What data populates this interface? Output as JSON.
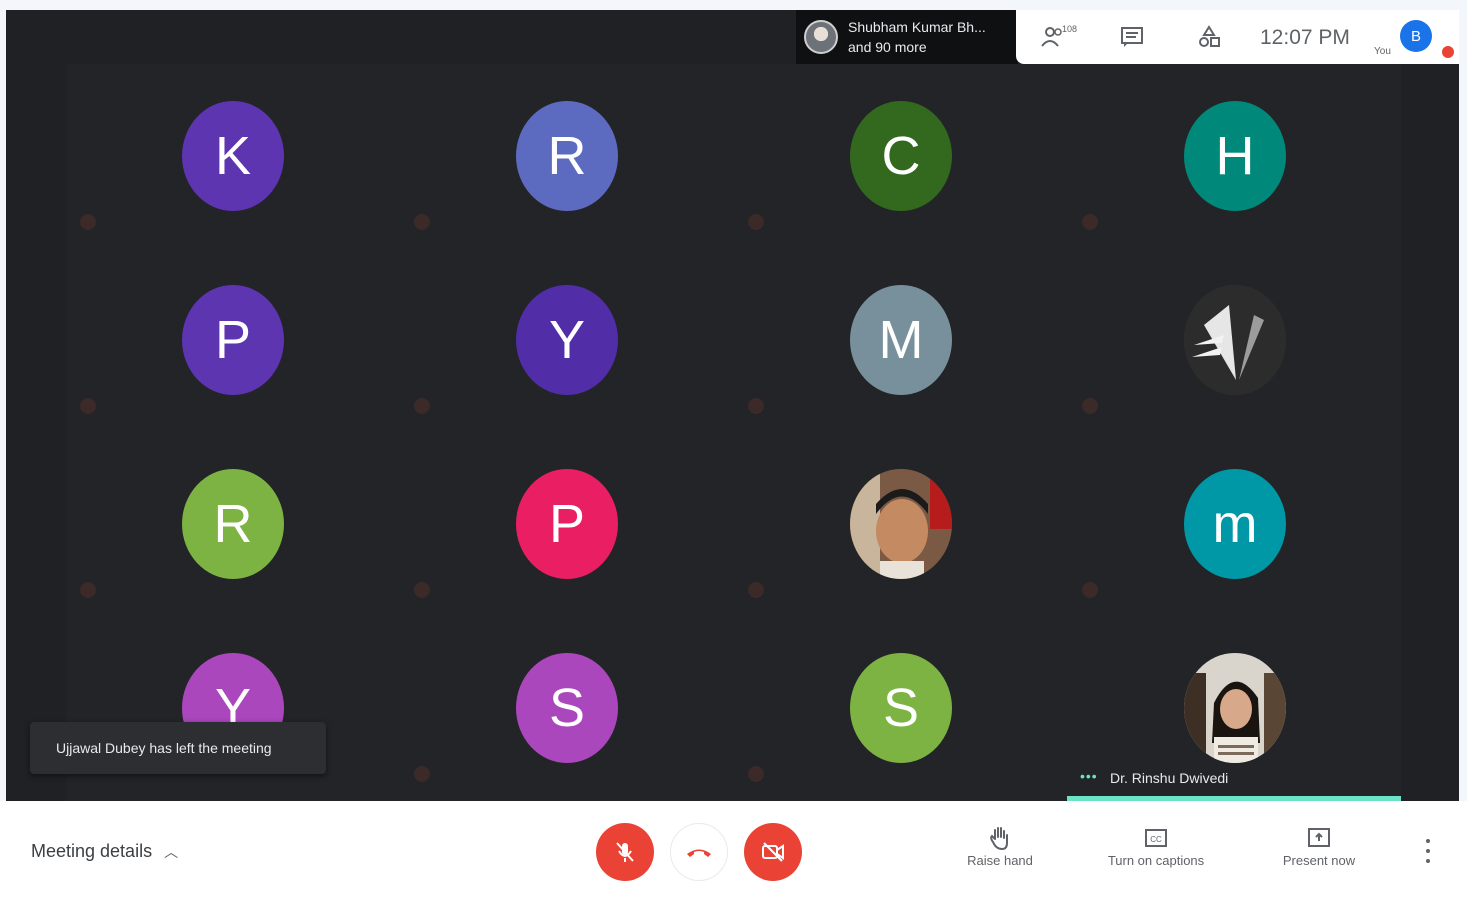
{
  "presenter": {
    "line1": "Shubham Kumar Bh...",
    "line2": "and 90 more"
  },
  "topbar": {
    "participant_count": "108",
    "time": "12:07 PM",
    "you_label": "You",
    "self_initial": "B"
  },
  "tiles": [
    {
      "initial": "K",
      "color": "#5e35b1",
      "name": ""
    },
    {
      "initial": "R",
      "color": "#5c6bc0",
      "name": ""
    },
    {
      "initial": "C",
      "color": "#33691e",
      "name": ""
    },
    {
      "initial": "H",
      "color": "#00897b",
      "name": ""
    },
    {
      "initial": "P",
      "color": "#5e35b1",
      "name": ""
    },
    {
      "initial": "Y",
      "color": "#512da8",
      "name": ""
    },
    {
      "initial": "M",
      "color": "#78909c",
      "name": ""
    },
    {
      "initial": "",
      "color": "#2b2b2b",
      "name": "",
      "photo": true
    },
    {
      "initial": "R",
      "color": "#7cb342",
      "name": ""
    },
    {
      "initial": "P",
      "color": "#e91e63",
      "name": ""
    },
    {
      "initial": "",
      "color": "#6d4c41",
      "name": "",
      "photo": true
    },
    {
      "initial": "m",
      "color": "#0097a7",
      "name": ""
    },
    {
      "initial": "Y",
      "color": "#ab47bc",
      "name": ""
    },
    {
      "initial": "S",
      "color": "#ab47bc",
      "name": ""
    },
    {
      "initial": "S",
      "color": "#7cb342",
      "name": ""
    },
    {
      "initial": "",
      "color": "#b0a89a",
      "name": "Dr. Rinshu Dwivedi",
      "photo": true
    }
  ],
  "toast": {
    "text": "Ujjawal Dubey has left the meeting"
  },
  "bottombar": {
    "meeting_details": "Meeting details",
    "raise_hand": "Raise hand",
    "captions": "Turn on captions",
    "present": "Present now"
  },
  "colors": {
    "accent_red": "#ea4335",
    "speaker_teal": "#6ce3c7",
    "stage_bg": "#202124"
  }
}
